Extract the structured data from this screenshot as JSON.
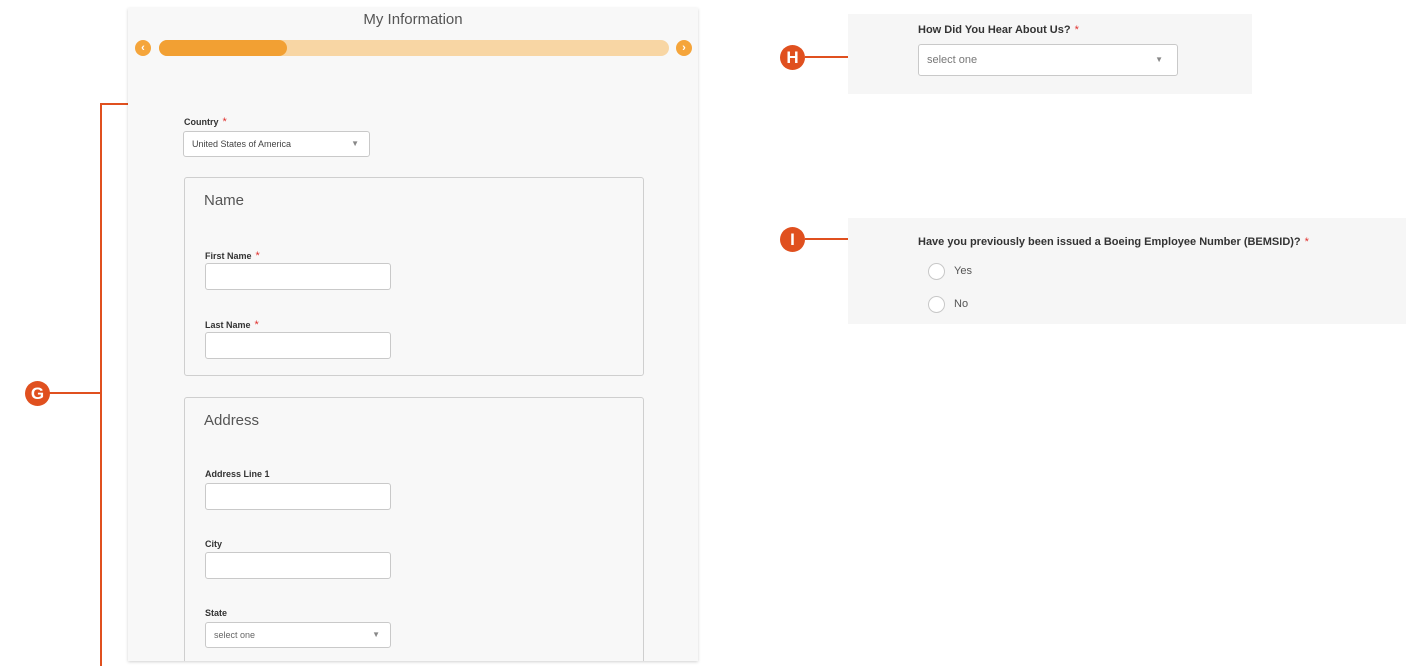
{
  "form": {
    "title": "My Information",
    "progress": 0.25,
    "prev_icon": "chevron-left-icon",
    "next_icon": "chevron-right-icon",
    "country": {
      "label": "Country",
      "required": "*",
      "value": "United States of America"
    },
    "name_section": {
      "title": "Name",
      "first_name_label": "First Name",
      "last_name_label": "Last Name",
      "required": "*"
    },
    "address_section": {
      "title": "Address",
      "line1_label": "Address Line 1",
      "city_label": "City",
      "state_label": "State",
      "state_placeholder": "select one"
    }
  },
  "callouts": {
    "g": "G",
    "h": "H",
    "i": "I"
  },
  "hear_about": {
    "label": "How Did You Hear About Us?",
    "required": "*",
    "placeholder": "select one"
  },
  "bemsid": {
    "question": "Have you previously been issued a Boeing Employee Number (BEMSID)?",
    "required": "*",
    "options": [
      "Yes",
      "No"
    ]
  },
  "colors": {
    "accent": "#f2a033",
    "track": "#f8d6a4",
    "callout": "#e0501f",
    "required": "#e0312e"
  }
}
